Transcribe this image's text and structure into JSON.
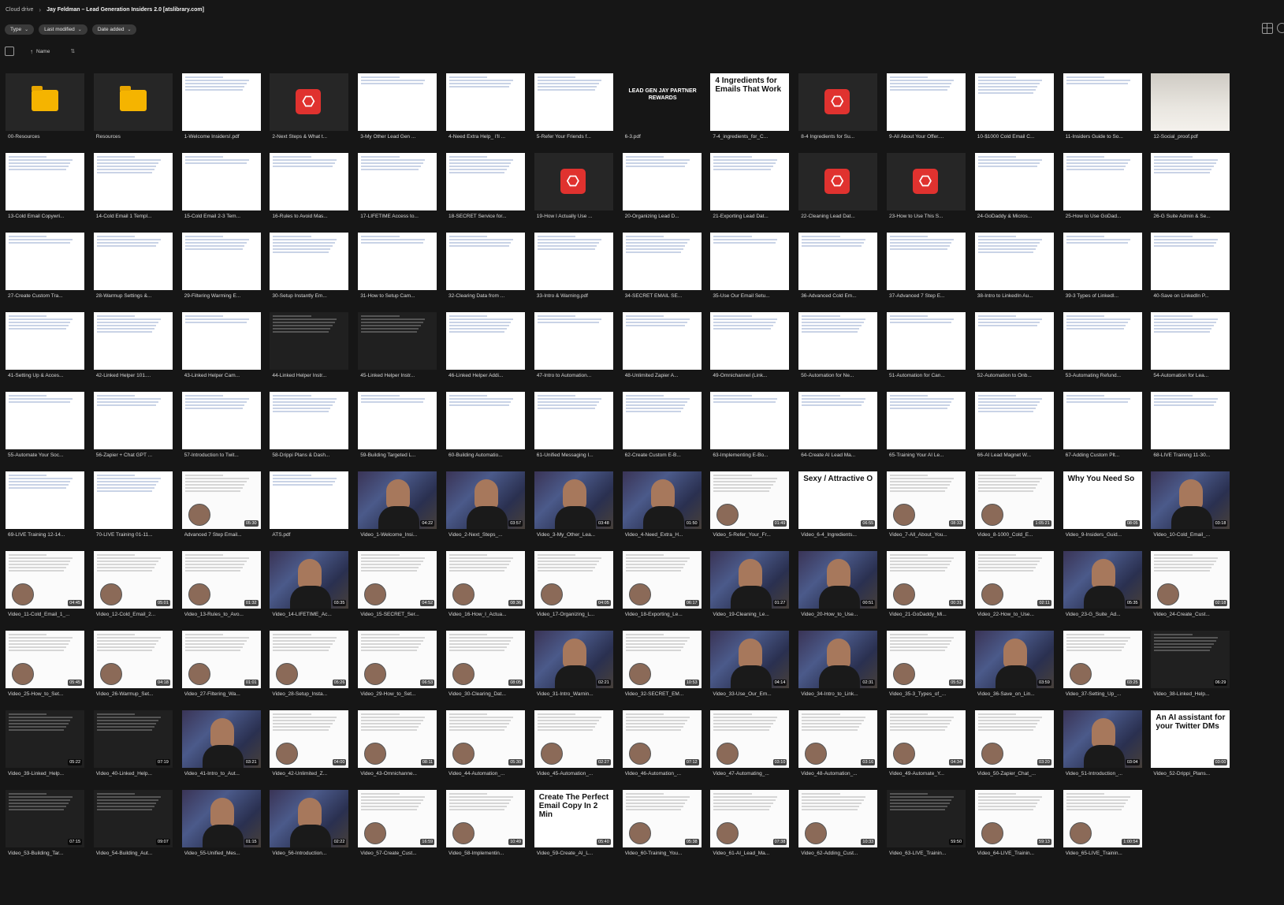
{
  "breadcrumb": {
    "root": "Cloud drive",
    "current": "Jay Feldman – Lead Generation Insiders 2.0 [atslibrary.com]"
  },
  "filters": [
    "Type",
    "Last modified",
    "Date added"
  ],
  "sort": {
    "label": "Name"
  },
  "files": [
    {
      "name": "00-Resources",
      "kind": "folder"
    },
    {
      "name": "Resources",
      "kind": "folder"
    },
    {
      "name": "1-Welcome Insiders!.pdf",
      "kind": "doc"
    },
    {
      "name": "2-Next Steps & What t...",
      "kind": "pdf"
    },
    {
      "name": "3-My Other Lead Gen ...",
      "kind": "doc"
    },
    {
      "name": "4-Need Extra Help_ I'll ...",
      "kind": "doc"
    },
    {
      "name": "5-Refer Your Friends f...",
      "kind": "doc"
    },
    {
      "name": "6-3.pdf",
      "kind": "slide",
      "text": "LEAD GEN JAY PARTNER REWARDS"
    },
    {
      "name": "7-4_ingredients_for_C...",
      "kind": "slide",
      "text": "4 Ingredients for Emails That Work"
    },
    {
      "name": "8-4 Ingredients for Su...",
      "kind": "pdf"
    },
    {
      "name": "9-All About Your Offer....",
      "kind": "doc"
    },
    {
      "name": "10-$1000 Cold Email C...",
      "kind": "doc"
    },
    {
      "name": "11-Insiders Guide to So...",
      "kind": "doc"
    },
    {
      "name": "12-Social_proof.pdf",
      "kind": "photo"
    },
    {
      "name": "13-Cold Email Copywri...",
      "kind": "doc"
    },
    {
      "name": "14-Cold Email 1 Templ...",
      "kind": "doc"
    },
    {
      "name": "15-Cold Email 2-3 Tem...",
      "kind": "doc"
    },
    {
      "name": "16-Rules to Avoid Mas...",
      "kind": "doc"
    },
    {
      "name": "17-LIFETIME Access to...",
      "kind": "doc"
    },
    {
      "name": "18-SECRET Service for...",
      "kind": "doc"
    },
    {
      "name": "19-How I Actually Use ...",
      "kind": "pdf"
    },
    {
      "name": "20-Organizing Lead D...",
      "kind": "doc"
    },
    {
      "name": "21-Exporting Lead Dat...",
      "kind": "doc"
    },
    {
      "name": "22-Cleaning Lead Dat...",
      "kind": "pdf"
    },
    {
      "name": "23-How to Use This S...",
      "kind": "pdf"
    },
    {
      "name": "24-GoDaddy & Micros...",
      "kind": "doc"
    },
    {
      "name": "25-How to Use GoDad...",
      "kind": "doc"
    },
    {
      "name": "26-G Suite Admin & Se...",
      "kind": "doc"
    },
    {
      "name": "27-Create Custom Tra...",
      "kind": "doc"
    },
    {
      "name": "28-Warmup Settings &...",
      "kind": "doc"
    },
    {
      "name": "29-Filtering Warming E...",
      "kind": "doc"
    },
    {
      "name": "30-Setup Instantly Em...",
      "kind": "doc"
    },
    {
      "name": "31-How to Setup Cam...",
      "kind": "doc"
    },
    {
      "name": "32-Clearing Data from ...",
      "kind": "doc"
    },
    {
      "name": "33-Intro & Warning.pdf",
      "kind": "doc"
    },
    {
      "name": "34-SECRET EMAIL SE...",
      "kind": "doc"
    },
    {
      "name": "35-Use Our Email Setu...",
      "kind": "doc"
    },
    {
      "name": "36-Advanced Cold Em...",
      "kind": "doc"
    },
    {
      "name": "37-Advanced 7 Step E...",
      "kind": "doc"
    },
    {
      "name": "38-Intro to LinkedIn Au...",
      "kind": "doc"
    },
    {
      "name": "39-3 Types of LinkedI...",
      "kind": "doc"
    },
    {
      "name": "40-Save on LinkedIn P...",
      "kind": "doc"
    },
    {
      "name": "41-Setting Up & Acces...",
      "kind": "doc"
    },
    {
      "name": "42-Linked Helper 101....",
      "kind": "doc"
    },
    {
      "name": "43-Linked Helper Cam...",
      "kind": "doc"
    },
    {
      "name": "44-Linked Helper Instr...",
      "kind": "darkslide"
    },
    {
      "name": "45-Linked Helper Instr...",
      "kind": "darkslide"
    },
    {
      "name": "46-Linked Helper Addi...",
      "kind": "doc"
    },
    {
      "name": "47-Intro to Automation...",
      "kind": "doc"
    },
    {
      "name": "48-Unlimited Zapier A...",
      "kind": "doc"
    },
    {
      "name": "49-Omnichannel (Link...",
      "kind": "doc"
    },
    {
      "name": "50-Automation for Ne...",
      "kind": "doc"
    },
    {
      "name": "51-Automation for Can...",
      "kind": "doc"
    },
    {
      "name": "52-Automation to Onb...",
      "kind": "doc"
    },
    {
      "name": "53-Automating Refund...",
      "kind": "doc"
    },
    {
      "name": "54-Automation for Lea...",
      "kind": "doc"
    },
    {
      "name": "55-Automate Your Soc...",
      "kind": "doc"
    },
    {
      "name": "56-Zapier + Chat GPT ...",
      "kind": "doc"
    },
    {
      "name": "57-Introduction to Twit...",
      "kind": "doc"
    },
    {
      "name": "58-Drippi Plans & Dash...",
      "kind": "doc"
    },
    {
      "name": "59-Building Targeted L...",
      "kind": "doc"
    },
    {
      "name": "60-Building Automatio...",
      "kind": "doc"
    },
    {
      "name": "61-Unified Messaging I...",
      "kind": "doc"
    },
    {
      "name": "62-Create Custom E-B...",
      "kind": "doc"
    },
    {
      "name": "63-Implementing E-Bo...",
      "kind": "doc"
    },
    {
      "name": "64-Create AI Lead Ma...",
      "kind": "doc"
    },
    {
      "name": "65-Training Your AI Le...",
      "kind": "doc"
    },
    {
      "name": "66-AI Lead Magnet W...",
      "kind": "doc"
    },
    {
      "name": "67-Adding Custom Plt...",
      "kind": "doc"
    },
    {
      "name": "68-LIVE Training 11-30...",
      "kind": "doc"
    },
    {
      "name": "69-LIVE Training 12-14...",
      "kind": "doc"
    },
    {
      "name": "70-LIVE Training 01-11...",
      "kind": "doc"
    },
    {
      "name": "Advanced 7 Step Email...",
      "kind": "screen",
      "dur": "05:30"
    },
    {
      "name": "ATS.pdf",
      "kind": "doc"
    },
    {
      "name": "Video_1-Welcome_Insi...",
      "kind": "video",
      "dur": "04:22"
    },
    {
      "name": "Video_2-Next_Steps_...",
      "kind": "video",
      "dur": "03:57"
    },
    {
      "name": "Video_3-My_Other_Lea...",
      "kind": "video",
      "dur": "03:48"
    },
    {
      "name": "Video_4-Need_Extra_H...",
      "kind": "video",
      "dur": "01:50"
    },
    {
      "name": "Video_5-Refer_Your_Fr...",
      "kind": "screen",
      "dur": "01:49"
    },
    {
      "name": "Video_6-4_Ingredients...",
      "kind": "slide",
      "text": "Sexy / Attractive O",
      "dur": "06:55"
    },
    {
      "name": "Video_7-All_About_You...",
      "kind": "screen",
      "dur": "08:33"
    },
    {
      "name": "Video_8-1000_Cold_E...",
      "kind": "screen",
      "dur": "1:05:21"
    },
    {
      "name": "Video_9-Insiders_Guid...",
      "kind": "slide",
      "text": "Why You Need So",
      "dur": "08:05"
    },
    {
      "name": "Video_10-Cold_Email_...",
      "kind": "video",
      "dur": "03:18"
    },
    {
      "name": "Video_11-Cold_Email_1_...",
      "kind": "screen",
      "dur": "04:45"
    },
    {
      "name": "Video_12-Cold_Email_2...",
      "kind": "screen",
      "dur": "05:01"
    },
    {
      "name": "Video_13-Rules_to_Avo...",
      "kind": "screen",
      "dur": "01:32"
    },
    {
      "name": "Video_14-LIFETIME_Ac...",
      "kind": "video",
      "dur": "03:35"
    },
    {
      "name": "Video_15-SECRET_Ser...",
      "kind": "screen",
      "dur": "04:52"
    },
    {
      "name": "Video_16-How_I_Actua...",
      "kind": "screen",
      "dur": "08:36"
    },
    {
      "name": "Video_17-Organizing_L...",
      "kind": "screen",
      "dur": "04:05"
    },
    {
      "name": "Video_18-Exporting_Le...",
      "kind": "screen",
      "dur": "06:17"
    },
    {
      "name": "Video_19-Cleaning_Le...",
      "kind": "video",
      "dur": "01:27"
    },
    {
      "name": "Video_20-How_to_Use...",
      "kind": "video",
      "dur": "00:51"
    },
    {
      "name": "Video_21-GoDaddy_Mi...",
      "kind": "screen",
      "dur": "00:31"
    },
    {
      "name": "Video_22-How_to_Use...",
      "kind": "screen",
      "dur": "02:11"
    },
    {
      "name": "Video_23-G_Suite_Ad...",
      "kind": "video",
      "dur": "05:35"
    },
    {
      "name": "Video_24-Create_Cust...",
      "kind": "screen",
      "dur": "02:18"
    },
    {
      "name": "Video_25-How_to_Set...",
      "kind": "screen",
      "dur": "05:45"
    },
    {
      "name": "Video_26-Warmup_Set...",
      "kind": "screen",
      "dur": "04:18"
    },
    {
      "name": "Video_27-Filtering_Wa...",
      "kind": "screen",
      "dur": "01:01"
    },
    {
      "name": "Video_28-Setup_Insta...",
      "kind": "screen",
      "dur": "05:26"
    },
    {
      "name": "Video_29-How_to_Set...",
      "kind": "screen",
      "dur": "06:53"
    },
    {
      "name": "Video_30-Clearing_Dat...",
      "kind": "screen",
      "dur": "08:05"
    },
    {
      "name": "Video_31-Intro_Warnin...",
      "kind": "video",
      "dur": "02:21"
    },
    {
      "name": "Video_32-SECRET_EM...",
      "kind": "screen",
      "dur": "10:53"
    },
    {
      "name": "Video_33-Use_Our_Em...",
      "kind": "video",
      "dur": "04:14"
    },
    {
      "name": "Video_34-Intro_to_Link...",
      "kind": "video",
      "dur": "02:31"
    },
    {
      "name": "Video_35-3_Types_of_...",
      "kind": "screen",
      "dur": "05:52"
    },
    {
      "name": "Video_36-Save_on_Lin...",
      "kind": "video",
      "dur": "03:59"
    },
    {
      "name": "Video_37-Setting_Up_...",
      "kind": "screen",
      "dur": "03:25"
    },
    {
      "name": "Video_38-Linked_Help...",
      "kind": "darkslide",
      "dur": "06:29"
    },
    {
      "name": "Video_39-Linked_Help...",
      "kind": "darkslide",
      "dur": "05:22"
    },
    {
      "name": "Video_40-Linked_Help...",
      "kind": "darkslide",
      "dur": "07:19"
    },
    {
      "name": "Video_41-Intro_to_Aut...",
      "kind": "video",
      "dur": "03:21"
    },
    {
      "name": "Video_42-Unlimited_Z...",
      "kind": "screen",
      "dur": "04:00"
    },
    {
      "name": "Video_43-Omnichanne...",
      "kind": "screen",
      "dur": "08:11"
    },
    {
      "name": "Video_44-Automation_...",
      "kind": "screen",
      "dur": "05:30"
    },
    {
      "name": "Video_45-Automation_...",
      "kind": "screen",
      "dur": "02:27"
    },
    {
      "name": "Video_46-Automation_...",
      "kind": "screen",
      "dur": "07:12"
    },
    {
      "name": "Video_47-Automating_...",
      "kind": "screen",
      "dur": "03:10"
    },
    {
      "name": "Video_48-Automation_...",
      "kind": "screen",
      "dur": "03:16"
    },
    {
      "name": "Video_49-Automate_Y...",
      "kind": "screen",
      "dur": "04:34"
    },
    {
      "name": "Video_50-Zapier_Chat_...",
      "kind": "screen",
      "dur": "03:20"
    },
    {
      "name": "Video_51-Introduction_...",
      "kind": "video",
      "dur": "03:04"
    },
    {
      "name": "Video_52-Drippi_Plans...",
      "kind": "slide",
      "text": "An AI assistant for your Twitter DMs",
      "dur": "03:00"
    },
    {
      "name": "Video_53-Building_Tar...",
      "kind": "darkslide",
      "dur": "07:15"
    },
    {
      "name": "Video_54-Building_Aut...",
      "kind": "darkslide",
      "dur": "09:07"
    },
    {
      "name": "Video_55-Unified_Mes...",
      "kind": "video",
      "dur": "01:15"
    },
    {
      "name": "Video_56-Introduction...",
      "kind": "video",
      "dur": "02:22"
    },
    {
      "name": "Video_57-Create_Cust...",
      "kind": "screen",
      "dur": "16:59"
    },
    {
      "name": "Video_58-Implementin...",
      "kind": "screen",
      "dur": "10:49"
    },
    {
      "name": "Video_59-Create_AI_L...",
      "kind": "slide",
      "text": "Create The Perfect Email Copy In 2 Min",
      "dur": "05:40"
    },
    {
      "name": "Video_60-Training_You...",
      "kind": "screen",
      "dur": "05:38"
    },
    {
      "name": "Video_61-AI_Lead_Ma...",
      "kind": "screen",
      "dur": "07:38"
    },
    {
      "name": "Video_62-Adding_Cust...",
      "kind": "screen",
      "dur": "10:33"
    },
    {
      "name": "Video_63-LIVE_Trainin...",
      "kind": "darkslide",
      "dur": "59:50"
    },
    {
      "name": "Video_64-LIVE_Trainin...",
      "kind": "screen",
      "dur": "59:13"
    },
    {
      "name": "Video_65-LIVE_Trainin...",
      "kind": "screen",
      "dur": "1:00:54"
    }
  ]
}
